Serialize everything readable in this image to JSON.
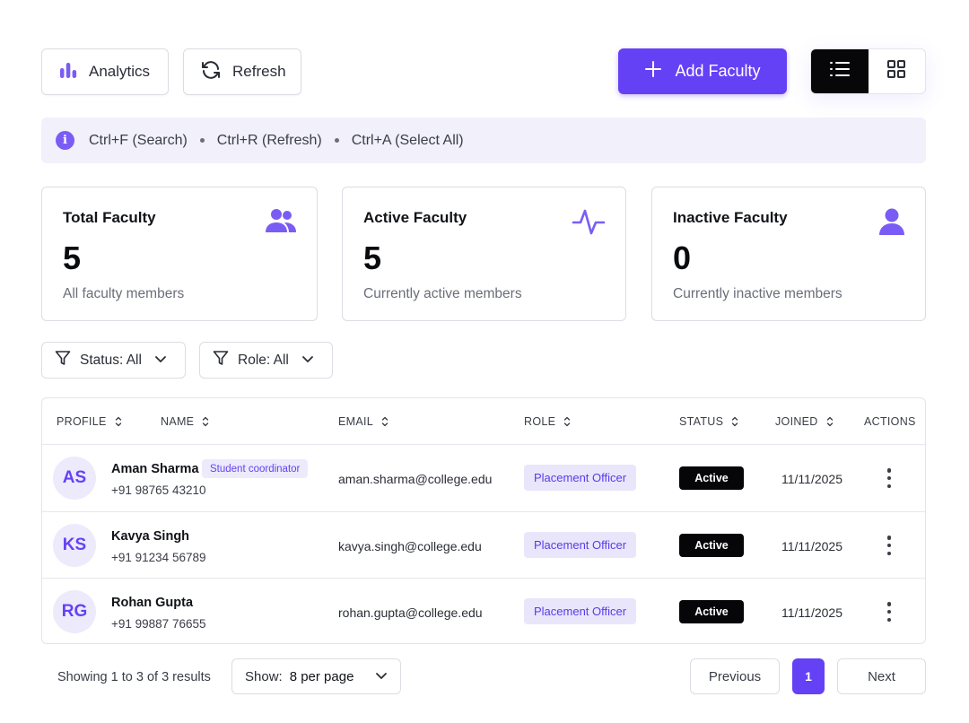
{
  "toolbar": {
    "analytics_label": "Analytics",
    "refresh_label": "Refresh",
    "add_label": "Add Faculty",
    "accent": "#6541f5"
  },
  "shortcuts": [
    "Ctrl+F (Search)",
    "Ctrl+R (Refresh)",
    "Ctrl+A (Select All)"
  ],
  "stats": [
    {
      "title": "Total Faculty",
      "value": "5",
      "sub": "All faculty members",
      "icon": "users-icon"
    },
    {
      "title": "Active Faculty",
      "value": "5",
      "sub": "Currently active members",
      "icon": "activity-icon"
    },
    {
      "title": "Inactive Faculty",
      "value": "0",
      "sub": "Currently inactive members",
      "icon": "user-icon"
    }
  ],
  "filters": {
    "status": "Status: All",
    "role": "Role: All"
  },
  "table": {
    "headers": {
      "profile": "PROFILE",
      "name": "NAME",
      "email": "EMAIL",
      "role": "ROLE",
      "status": "STATUS",
      "joined": "JOINED",
      "actions": "ACTIONS"
    },
    "rows": [
      {
        "initials": "AS",
        "name": "Aman Sharma",
        "tag": "Student coordinator",
        "phone": "+91 98765 43210",
        "email": "aman.sharma@college.edu",
        "role": "Placement Officer",
        "status": "Active",
        "joined": "11/11/2025"
      },
      {
        "initials": "KS",
        "name": "Kavya Singh",
        "phone": "+91 91234 56789",
        "email": "kavya.singh@college.edu",
        "role": "Placement Officer",
        "status": "Active",
        "joined": "11/11/2025"
      },
      {
        "initials": "RG",
        "name": "Rohan Gupta",
        "phone": "+91 99887 76655",
        "email": "rohan.gupta@college.edu",
        "role": "Placement Officer",
        "status": "Active",
        "joined": "11/11/2025"
      }
    ]
  },
  "pagination": {
    "showing": "Showing 1 to 3 of 3 results",
    "show_label": "Show:",
    "per_page": "8 per page",
    "previous": "Previous",
    "current": "1",
    "next": "Next"
  }
}
